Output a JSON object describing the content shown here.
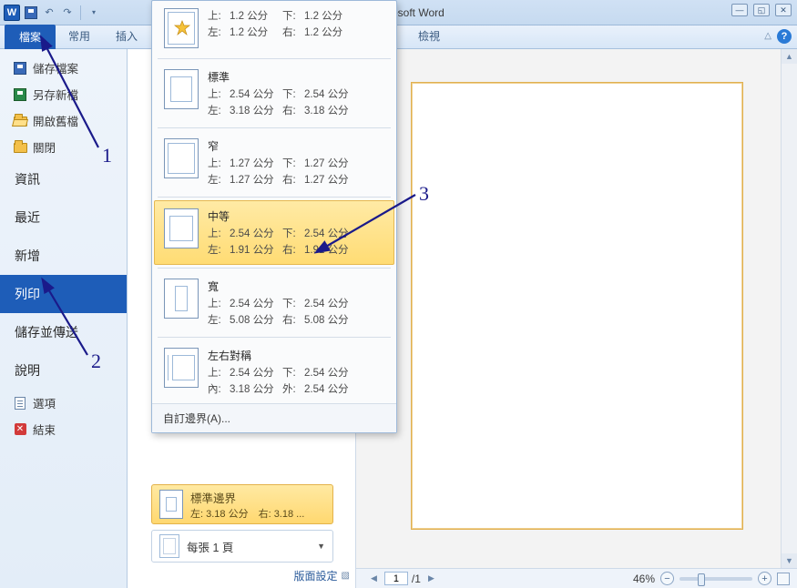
{
  "titlebar": {
    "title_suffix": "osoft Word"
  },
  "tabs": {
    "file": "檔案",
    "home": "常用",
    "insert": "插入",
    "view": "檢視"
  },
  "sidebar": {
    "save": "儲存檔案",
    "saveas": "另存新檔",
    "open": "開啟舊檔",
    "close": "關閉",
    "info": "資訊",
    "recent": "最近",
    "new": "新增",
    "print": "列印",
    "savesend": "儲存並傳送",
    "help": "說明",
    "options": "選項",
    "exit": "結束"
  },
  "margins": {
    "last": {
      "name": "",
      "top": "1.2 公分",
      "bottom": "1.2 公分",
      "left": "1.2 公分",
      "right": "1.2 公分"
    },
    "normal": {
      "name": "標準",
      "top": "2.54 公分",
      "bottom": "2.54 公分",
      "left": "3.18 公分",
      "right": "3.18 公分"
    },
    "narrow": {
      "name": "窄",
      "top": "1.27 公分",
      "bottom": "1.27 公分",
      "left": "1.27 公分",
      "right": "1.27 公分"
    },
    "moderate": {
      "name": "中等",
      "top": "2.54 公分",
      "bottom": "2.54 公分",
      "left": "1.91 公分",
      "right": "1.91 公分"
    },
    "wide": {
      "name": "寬",
      "top": "2.54 公分",
      "bottom": "2.54 公分",
      "left": "5.08 公分",
      "right": "5.08 公分"
    },
    "mirrored": {
      "name": "左右對稱",
      "top": "2.54 公分",
      "bottom": "2.54 公分",
      "inner": "3.18 公分",
      "outer": "2.54 公分"
    },
    "labels": {
      "top": "上:",
      "bottom": "下:",
      "left": "左:",
      "right": "右:",
      "inner": "內:",
      "outer": "外:"
    },
    "custom": "自訂邊界(A)..."
  },
  "current_margin": {
    "name": "標準邊界",
    "detail": "左: 3.18 公分　右: 3.18 ..."
  },
  "sheets_per_page": "每張 1 頁",
  "page_setup_link": "版面設定",
  "status": {
    "page_current": "1",
    "page_total": "/1",
    "zoom": "46%"
  },
  "annotations": {
    "n1": "1",
    "n2": "2",
    "n3": "3"
  }
}
